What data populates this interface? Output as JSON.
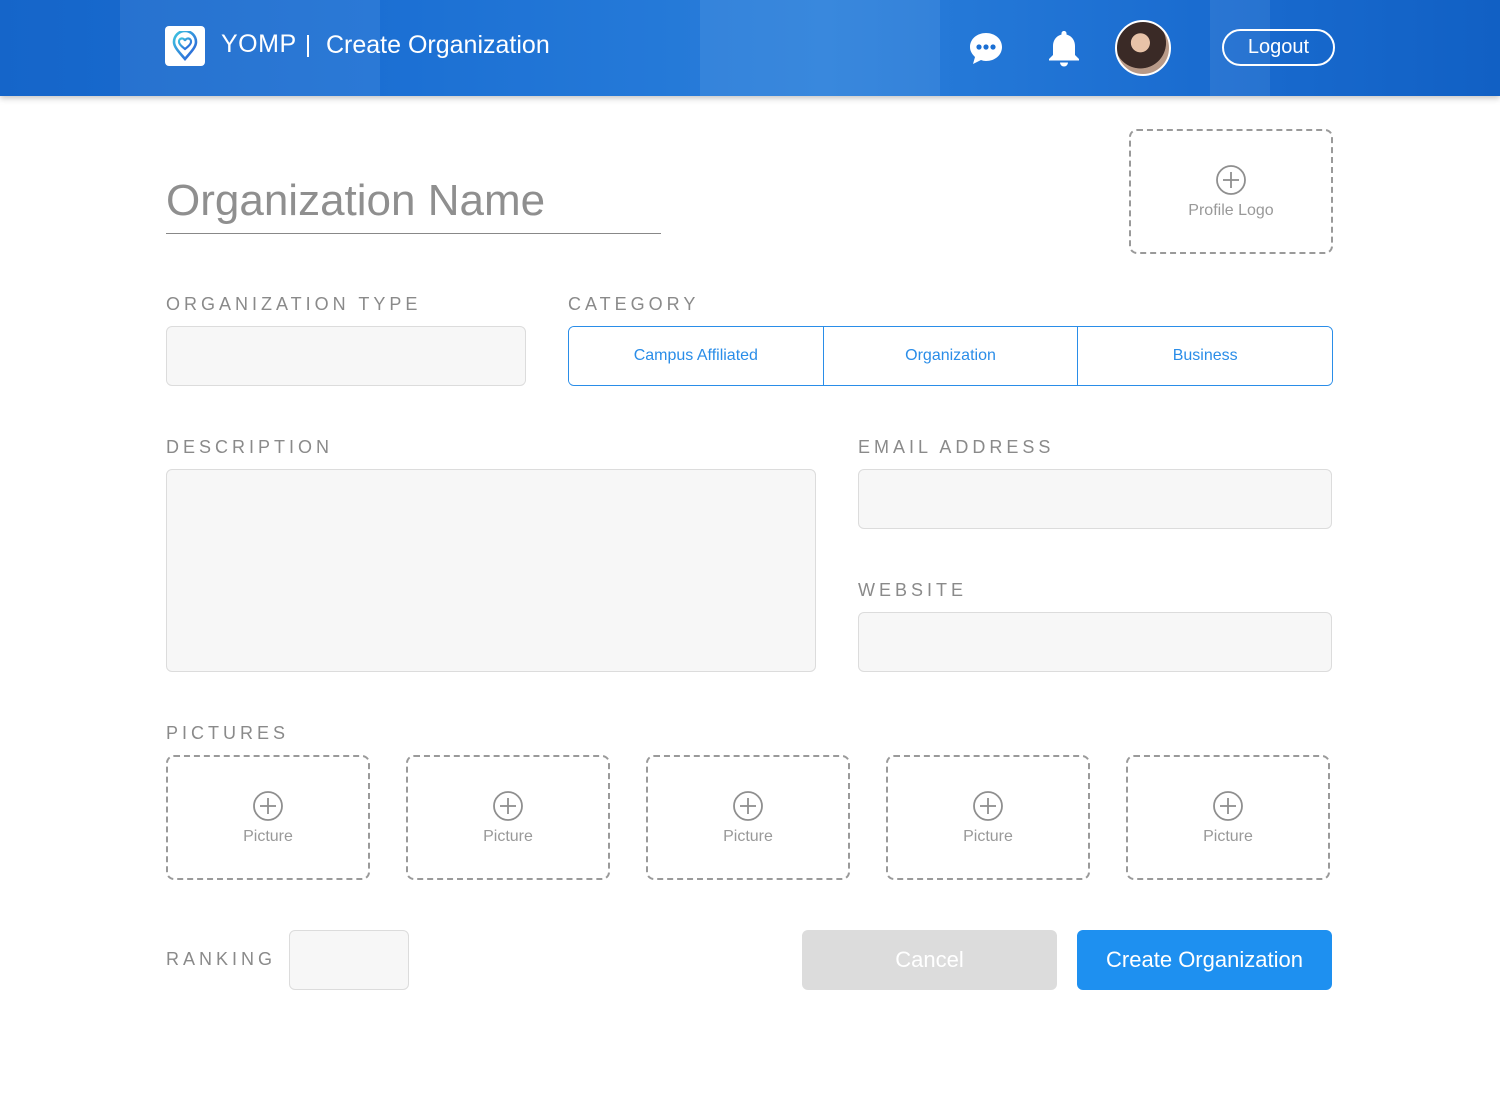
{
  "header": {
    "brand": "YOMP",
    "page_title": "Create Organization",
    "logout_label": "Logout",
    "icons": {
      "chat": "chat-bubble-icon",
      "notifications": "bell-icon",
      "logo": "location-heart-icon"
    }
  },
  "form": {
    "org_name_placeholder": "Organization Name",
    "profile_logo_label": "Profile Logo",
    "organization_type": {
      "label": "ORGANIZATION TYPE",
      "value": ""
    },
    "category": {
      "label": "CATEGORY",
      "options": [
        "Campus Affiliated",
        "Organization",
        "Business"
      ]
    },
    "description": {
      "label": "DESCRIPTION",
      "value": ""
    },
    "email": {
      "label": "EMAIL ADDRESS",
      "value": ""
    },
    "website": {
      "label": "WEBSITE",
      "value": ""
    },
    "pictures": {
      "label": "PICTURES",
      "slots": [
        "Picture",
        "Picture",
        "Picture",
        "Picture",
        "Picture"
      ]
    },
    "ranking": {
      "label": "RANKING",
      "value": ""
    },
    "cancel_label": "Cancel",
    "submit_label": "Create Organization"
  },
  "colors": {
    "accent": "#1e90f0",
    "header": "#1b6fd3",
    "field_bg": "#f7f7f7",
    "cancel_bg": "#dcdcdc"
  }
}
